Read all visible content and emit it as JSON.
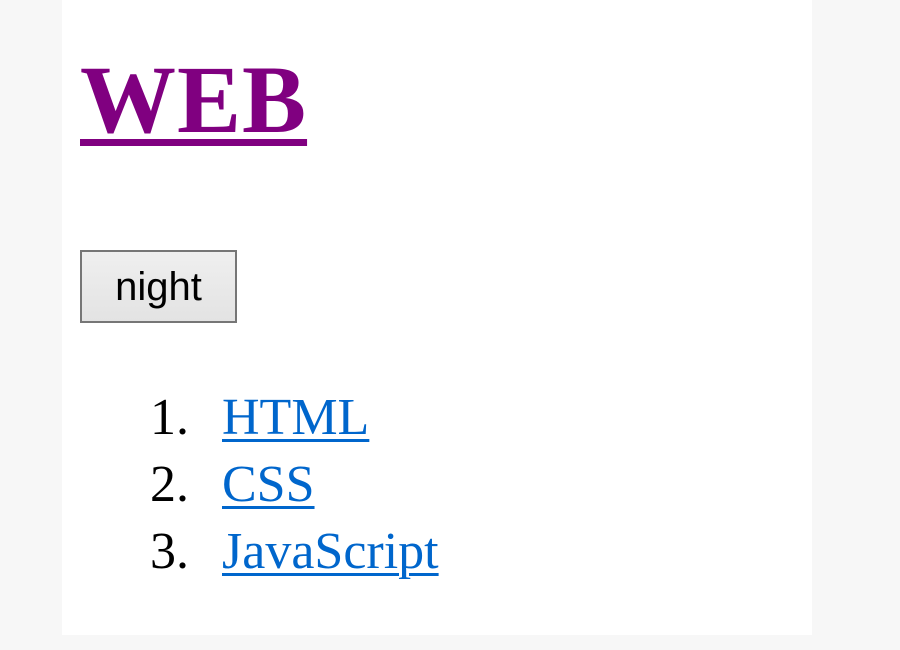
{
  "page": {
    "title": "WEB",
    "night_button_label": "night"
  },
  "nav": {
    "items": [
      {
        "number": "1.",
        "label": "HTML"
      },
      {
        "number": "2.",
        "label": "CSS"
      },
      {
        "number": "3.",
        "label": "JavaScript"
      }
    ]
  },
  "colors": {
    "visited_link": "#800080",
    "link": "#0066cc",
    "text": "#000000",
    "background": "#ffffff"
  }
}
